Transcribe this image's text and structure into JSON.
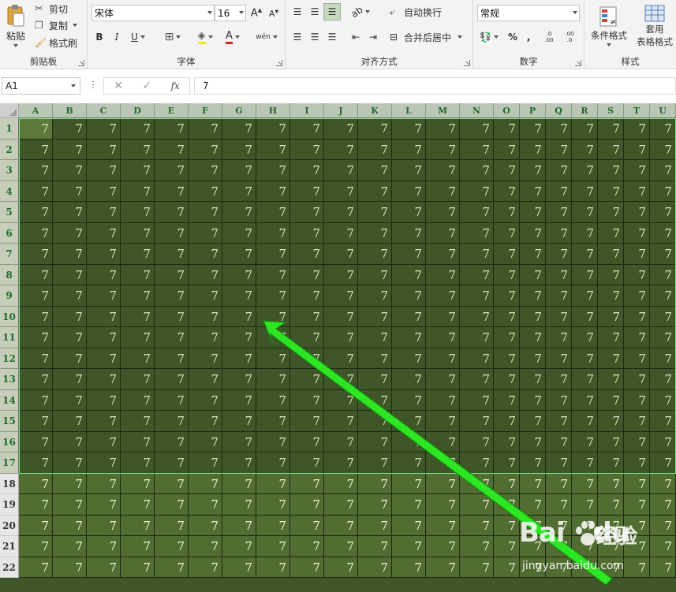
{
  "ribbon": {
    "clipboard": {
      "label": "剪贴板",
      "paste": "粘贴",
      "cut": "剪切",
      "copy": "复制",
      "format_painter": "格式刷"
    },
    "font": {
      "label": "字体",
      "name": "宋体",
      "size": "16",
      "bold": "B",
      "italic": "I",
      "underline": "U",
      "phonetic": "wén"
    },
    "alignment": {
      "label": "对齐方式",
      "wrap": "自动换行",
      "merge": "合并后居中"
    },
    "number": {
      "label": "数字",
      "format": "常规",
      "percent": "%",
      "comma": ",",
      "inc_decimal": ".0 .00",
      "dec_decimal": ".00 .0"
    },
    "styles": {
      "label": "样式",
      "conditional": "条件格式",
      "table_line1": "套用",
      "table_line2": "表格格式"
    }
  },
  "formula_bar": {
    "name_box": "A1",
    "cancel": "✕",
    "enter": "✓",
    "fx": "fx",
    "content": "7"
  },
  "sheet": {
    "columns": [
      "A",
      "B",
      "C",
      "D",
      "E",
      "F",
      "G",
      "H",
      "I",
      "J",
      "K",
      "L",
      "M",
      "N",
      "O",
      "P",
      "Q",
      "R",
      "S",
      "T",
      "U"
    ],
    "rows": [
      "1",
      "2",
      "3",
      "4",
      "5",
      "6",
      "7",
      "8",
      "9",
      "10",
      "11",
      "12",
      "13",
      "14",
      "15",
      "16",
      "17",
      "18",
      "19",
      "20",
      "21",
      "22"
    ],
    "cell_value": "7",
    "selection": "A1:U17"
  },
  "watermark": {
    "brand": "Bai",
    "brand_tail": "du",
    "cn": "经验",
    "url": "jingyan.baidu.com"
  },
  "colors": {
    "sheet_fill": "#3e5628",
    "header_green": "#1f6b2a",
    "arrow": "#22e619",
    "selection_border": "#7fe48c"
  }
}
